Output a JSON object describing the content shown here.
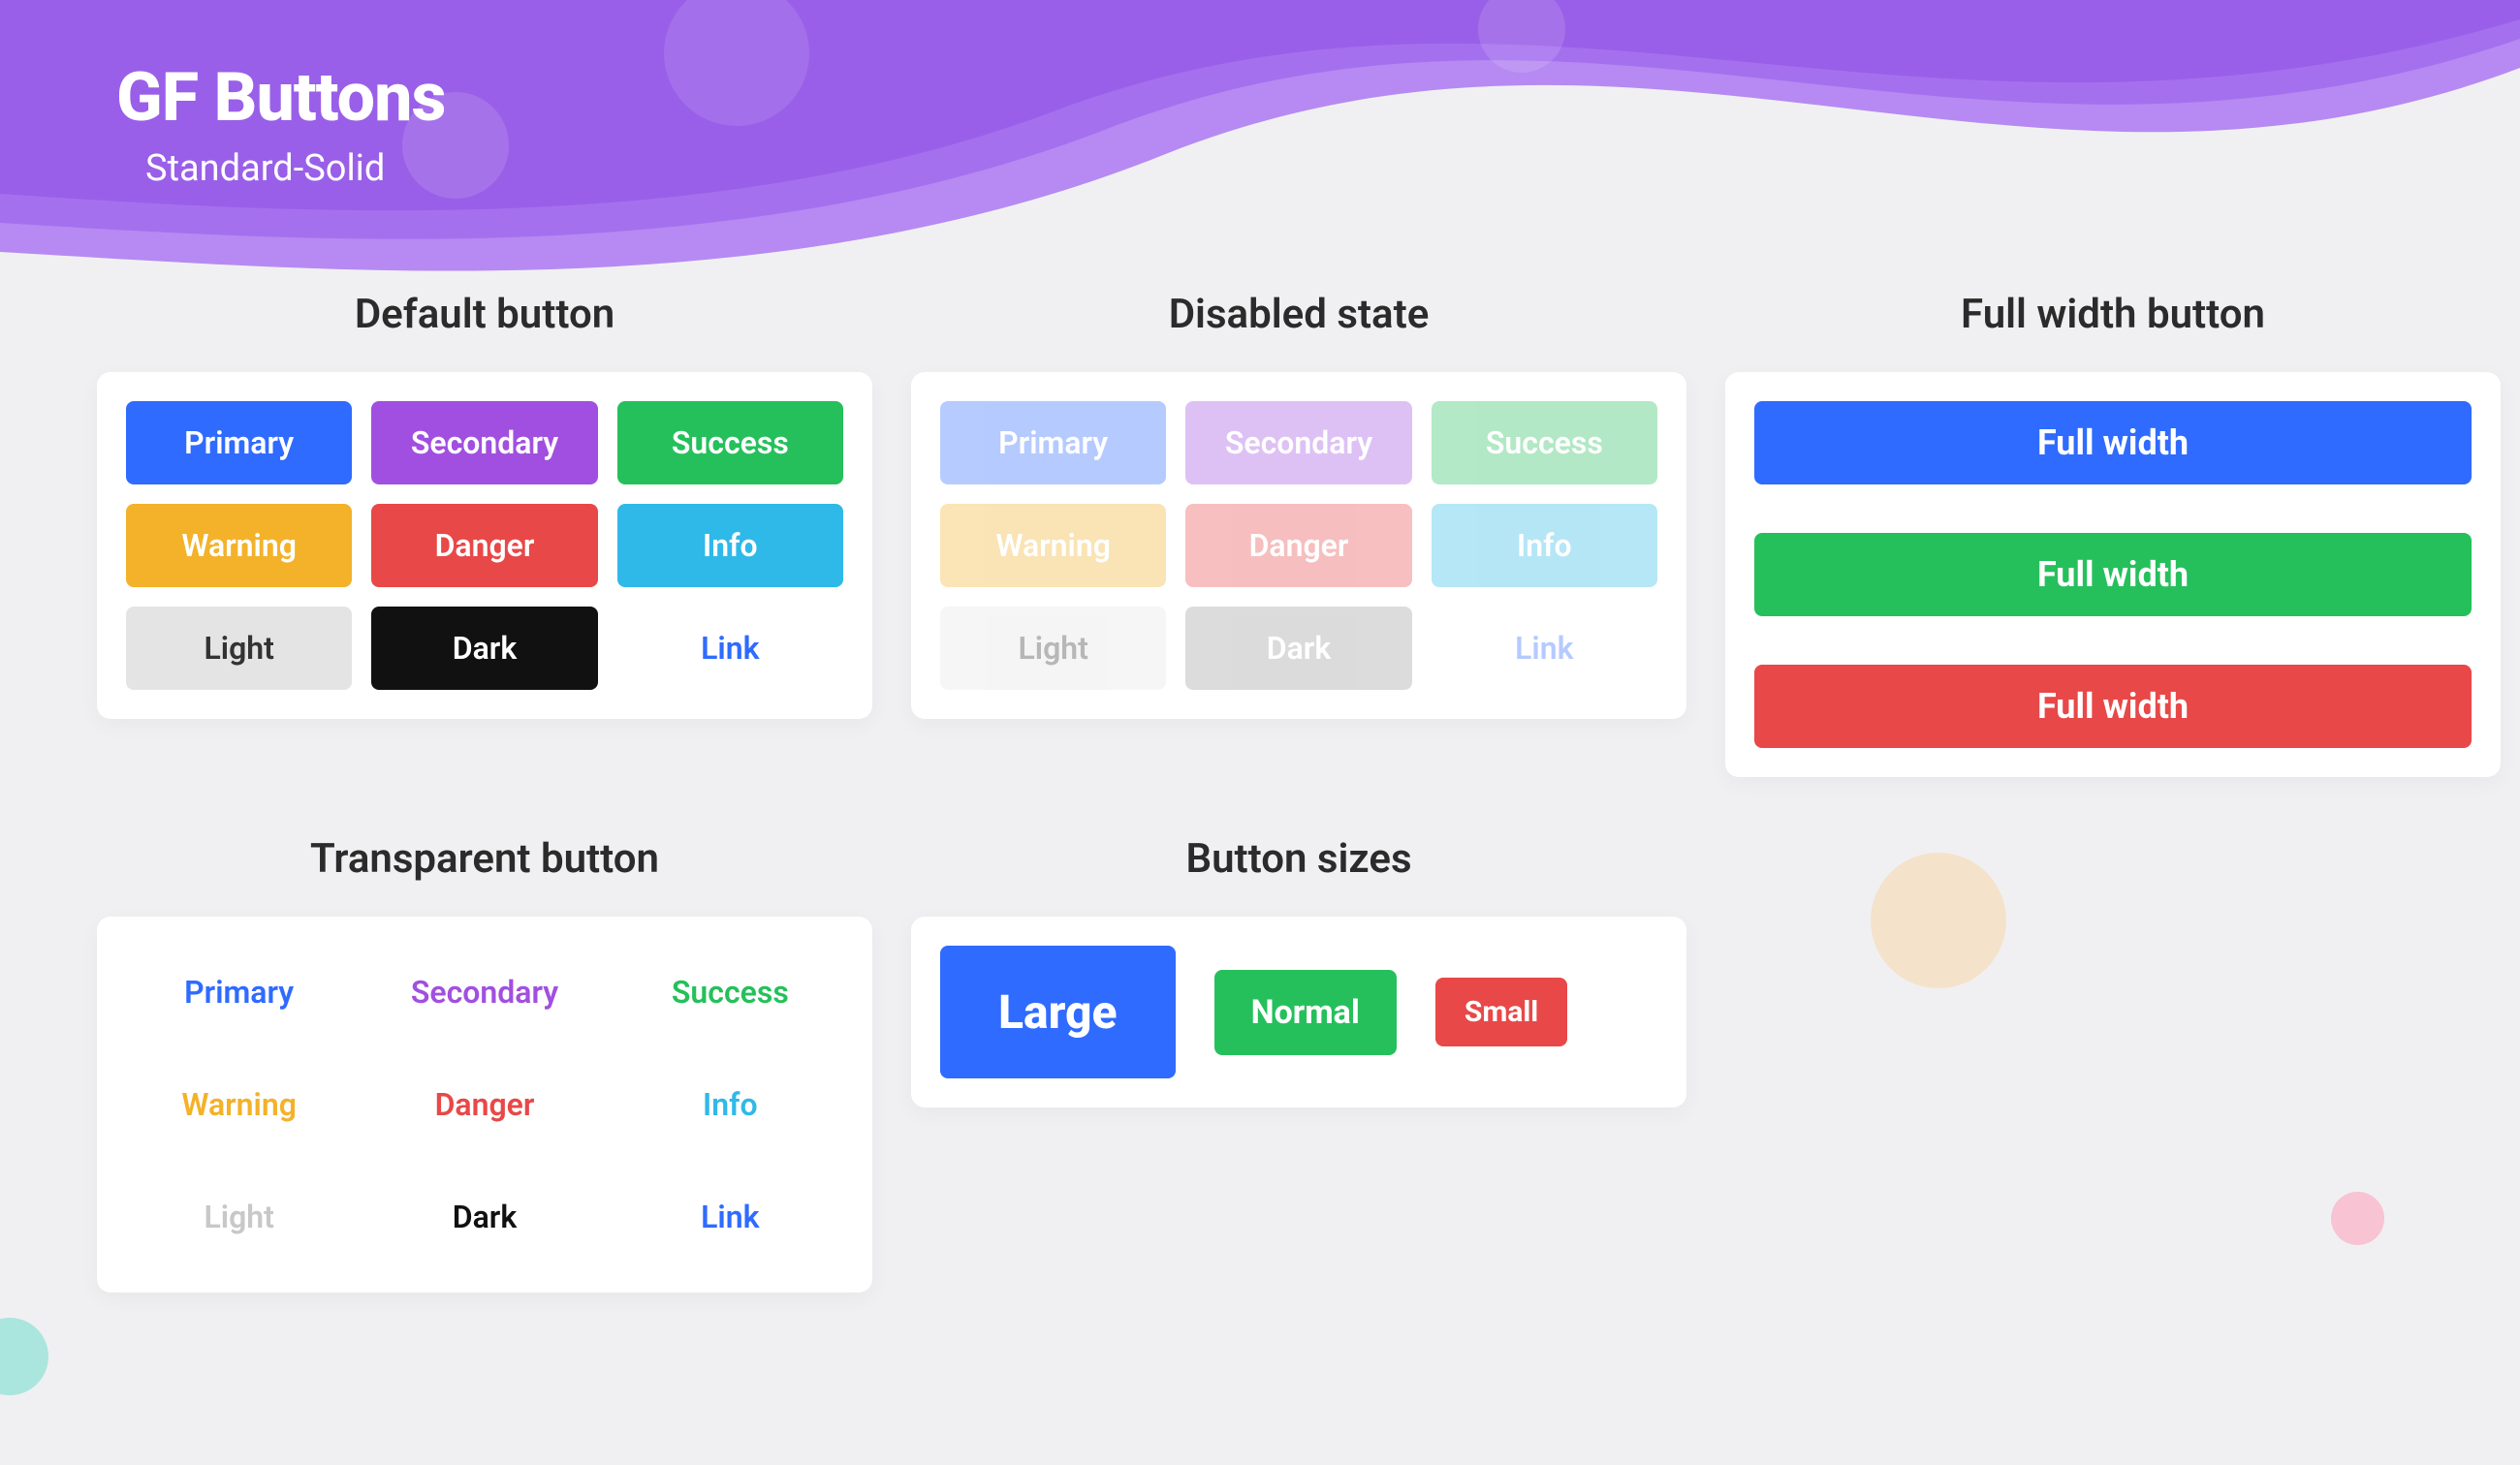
{
  "hero": {
    "title": "GF Buttons",
    "subtitle": "Standard-Solid"
  },
  "colors": {
    "primary": "#2f6bff",
    "secondary": "#a14fe0",
    "success": "#25c05b",
    "warning": "#f3b22a",
    "danger": "#e84848",
    "info": "#2fb9e8",
    "light": "#e4e4e4",
    "dark": "#111111",
    "link": "#2f6bff"
  },
  "sections": {
    "default": {
      "title": "Default button"
    },
    "disabled": {
      "title": "Disabled  state"
    },
    "full_width": {
      "title": "Full width button"
    },
    "transparent": {
      "title": "Transparent button"
    },
    "sizes": {
      "title": "Button sizes"
    }
  },
  "labels": {
    "primary": "Primary",
    "secondary": "Secondary",
    "success": "Success",
    "warning": "Warning",
    "danger": "Danger",
    "info": "Info",
    "light": "Light",
    "dark": "Dark",
    "link": "Link"
  },
  "full_width_label": "Full width",
  "sizes_labels": {
    "large": "Large",
    "normal": "Normal",
    "small": "Small"
  }
}
